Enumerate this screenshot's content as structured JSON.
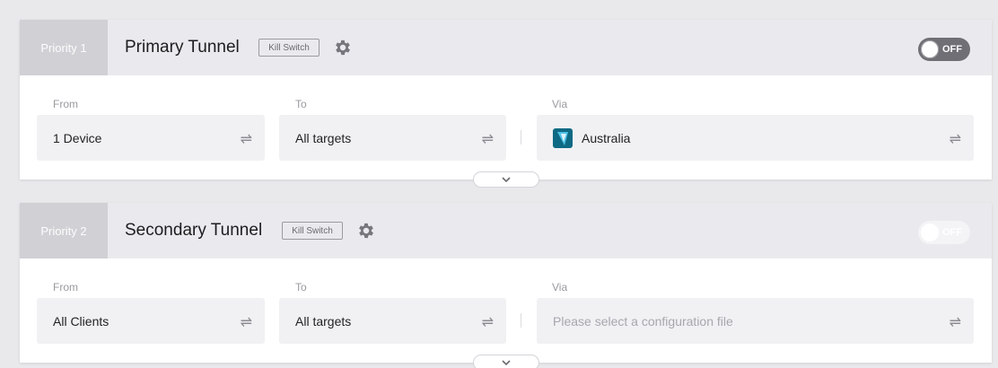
{
  "tunnels": [
    {
      "priority": "Priority 1",
      "name": "Primary Tunnel",
      "kill_switch": "Kill Switch",
      "toggle": "OFF",
      "from_label": "From",
      "from_value": "1 Device",
      "to_label": "To",
      "to_value": "All targets",
      "via_label": "Via",
      "via_value": "Australia",
      "via_icon": "vpn-provider-icon"
    },
    {
      "priority": "Priority 2",
      "name": "Secondary Tunnel",
      "kill_switch": "Kill Switch",
      "toggle": "OFF",
      "from_label": "From",
      "from_value": "All Clients",
      "to_label": "To",
      "to_value": "All targets",
      "via_label": "Via",
      "via_placeholder": "Please select a configuration file"
    }
  ],
  "colors": {
    "background": "#e9e9ec",
    "header": "#eaeaee",
    "priority_tab": "#d0d0d5",
    "field": "#f1f1f4",
    "toggle_active": "#6f6f75",
    "flag": "#0e6a84"
  },
  "icons": {
    "gear": "gear-icon",
    "swap": "swap-arrows-icon",
    "expand": "chevron-down-icon"
  }
}
